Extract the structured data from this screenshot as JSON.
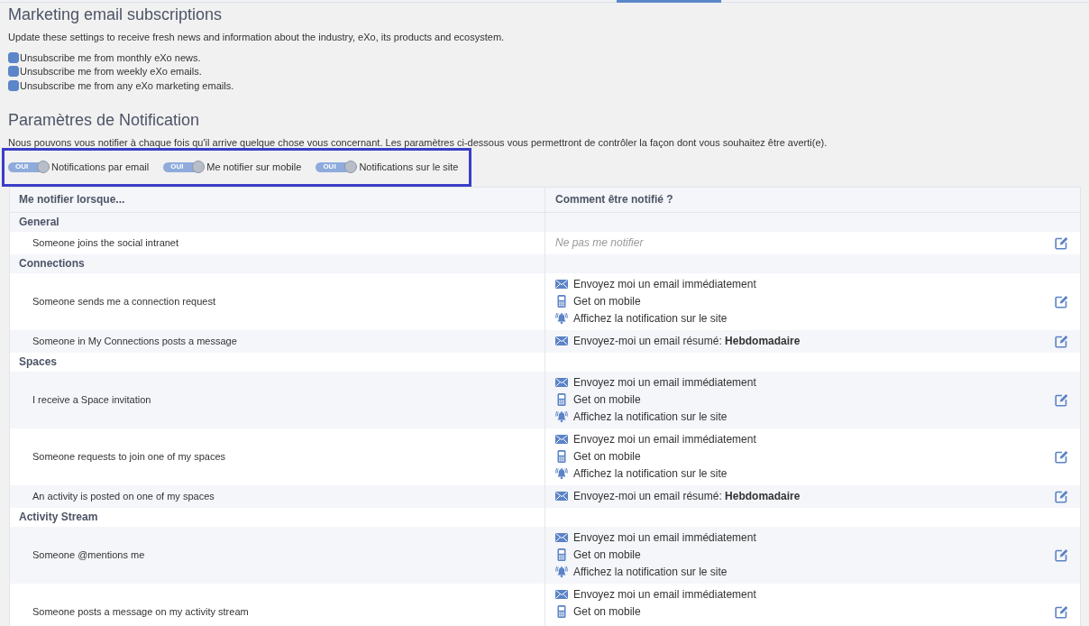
{
  "marketing": {
    "title": "Marketing email subscriptions",
    "description": "Update these settings to receive fresh news and information about the industry, eXo, its products and ecosystem.",
    "options": [
      {
        "label": "Unsubscribe me from monthly eXo news.",
        "checked": true
      },
      {
        "label": "Unsubscribe me from weekly eXo emails.",
        "checked": true
      },
      {
        "label": "Unsubscribe me from any eXo marketing emails.",
        "checked": true
      }
    ]
  },
  "notification_settings": {
    "title": "Paramètres de Notification",
    "description": "Nous pouvons vous notifier à chaque fois qu'il arrive quelque chose vous concernant. Les paramètres ci-dessous vous permettront de contrôler la façon dont vous souhaitez être averti(e).",
    "toggles": [
      {
        "state_label": "OUI",
        "label": "Notifications par email",
        "on": true
      },
      {
        "state_label": "OUI",
        "label": "Me notifier sur mobile",
        "on": true
      },
      {
        "state_label": "OUI",
        "label": "Notifications sur le site",
        "on": true
      }
    ],
    "table": {
      "columns": [
        "Me notifier lorsque...",
        "Comment être notifié ?"
      ],
      "groups": [
        {
          "name": "General",
          "rows": [
            {
              "event": "Someone joins the social intranet",
              "channels": [
                {
                  "kind": "none",
                  "text": "Ne pas me notifier"
                }
              ]
            }
          ]
        },
        {
          "name": "Connections",
          "rows": [
            {
              "event": "Someone sends me a connection request",
              "channels": [
                {
                  "kind": "email",
                  "text": "Envoyez moi un email immédiatement"
                },
                {
                  "kind": "mobile",
                  "text": "Get on mobile"
                },
                {
                  "kind": "site",
                  "text": "Affichez la notification sur le site"
                }
              ]
            },
            {
              "event": "Someone in My Connections posts a message",
              "channels": [
                {
                  "kind": "email",
                  "text": "Envoyez-moi un email résumé: **Hebdomadaire**"
                }
              ]
            }
          ]
        },
        {
          "name": "Spaces",
          "rows": [
            {
              "event": "I receive a Space invitation",
              "channels": [
                {
                  "kind": "email",
                  "text": "Envoyez moi un email immédiatement"
                },
                {
                  "kind": "mobile",
                  "text": "Get on mobile"
                },
                {
                  "kind": "site",
                  "text": "Affichez la notification sur le site"
                }
              ]
            },
            {
              "event": "Someone requests to join one of my spaces",
              "channels": [
                {
                  "kind": "email",
                  "text": "Envoyez moi un email immédiatement"
                },
                {
                  "kind": "mobile",
                  "text": "Get on mobile"
                },
                {
                  "kind": "site",
                  "text": "Affichez la notification sur le site"
                }
              ]
            },
            {
              "event": "An activity is posted on one of my spaces",
              "channels": [
                {
                  "kind": "email",
                  "text": "Envoyez-moi un email résumé: **Hebdomadaire**"
                }
              ]
            }
          ]
        },
        {
          "name": "Activity Stream",
          "rows": [
            {
              "event": "Someone @mentions me",
              "channels": [
                {
                  "kind": "email",
                  "text": "Envoyez moi un email immédiatement"
                },
                {
                  "kind": "mobile",
                  "text": "Get on mobile"
                },
                {
                  "kind": "site",
                  "text": "Affichez la notification sur le site"
                }
              ]
            },
            {
              "event": "Someone posts a message on my activity stream",
              "channels": [
                {
                  "kind": "email",
                  "text": "Envoyez moi un email immédiatement"
                },
                {
                  "kind": "mobile",
                  "text": "Get on mobile"
                }
              ]
            }
          ]
        }
      ]
    }
  }
}
